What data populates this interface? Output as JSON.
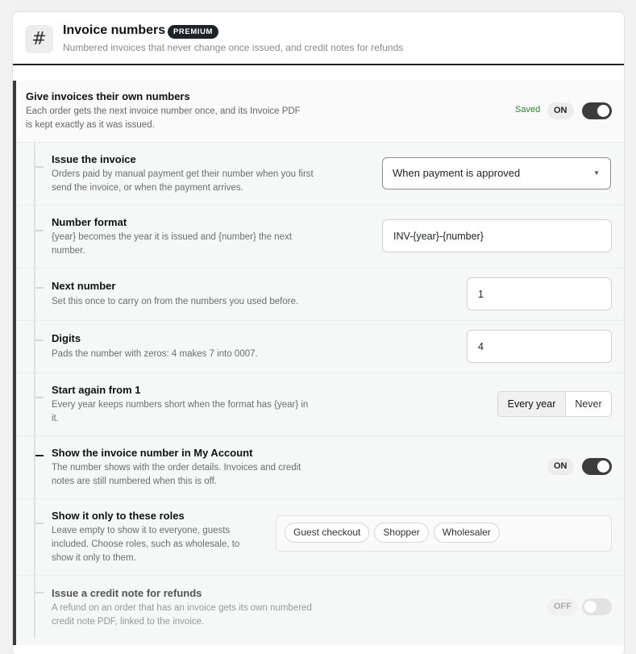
{
  "header": {
    "icon": "hash-icon",
    "icon_glyph": "#",
    "title": "Invoice numbers",
    "badge": "PREMIUM",
    "subtitle": "Numbered invoices that never change once issued, and credit notes for refunds"
  },
  "main": {
    "title": "Give invoices their own numbers",
    "desc": "Each order gets the next invoice number once, and its Invoice PDF is kept exactly as it was issued.",
    "saved": "Saved",
    "state": "ON",
    "enabled": true
  },
  "rows": {
    "issue": {
      "label": "Issue the invoice",
      "desc": "Orders paid by manual payment get their number when you first send the invoice, or when the payment arrives.",
      "value": "When payment is approved"
    },
    "format": {
      "label": "Number format",
      "desc": "{year} becomes the year it is issued and {number} the next number.",
      "value": "INV-{year}-{number}"
    },
    "next": {
      "label": "Next number",
      "desc": "Set this once to carry on from the numbers you used before.",
      "value": "1"
    },
    "digits": {
      "label": "Digits",
      "desc": "Pads the number with zeros: 4 makes 7 into 0007.",
      "value": "4"
    },
    "restart": {
      "label": "Start again from 1",
      "desc": "Every year keeps numbers short when the format has {year} in it.",
      "options": [
        "Every year",
        "Never"
      ],
      "selected": "Every year"
    },
    "myaccount": {
      "label": "Show the invoice number in My Account",
      "desc": "The number shows with the order details. Invoices and credit notes are still numbered when this is off.",
      "state": "ON",
      "enabled": true
    },
    "roles": {
      "label": "Show it only to these roles",
      "desc": "Leave empty to show it to everyone, guests included. Choose roles, such as wholesale, to show it only to them.",
      "tags": [
        "Guest checkout",
        "Shopper",
        "Wholesaler"
      ]
    },
    "credit": {
      "label": "Issue a credit note for refunds",
      "desc": "A refund on an order that has an invoice gets its own numbered credit note PDF, linked to the invoice.",
      "state": "OFF",
      "enabled": false
    }
  }
}
